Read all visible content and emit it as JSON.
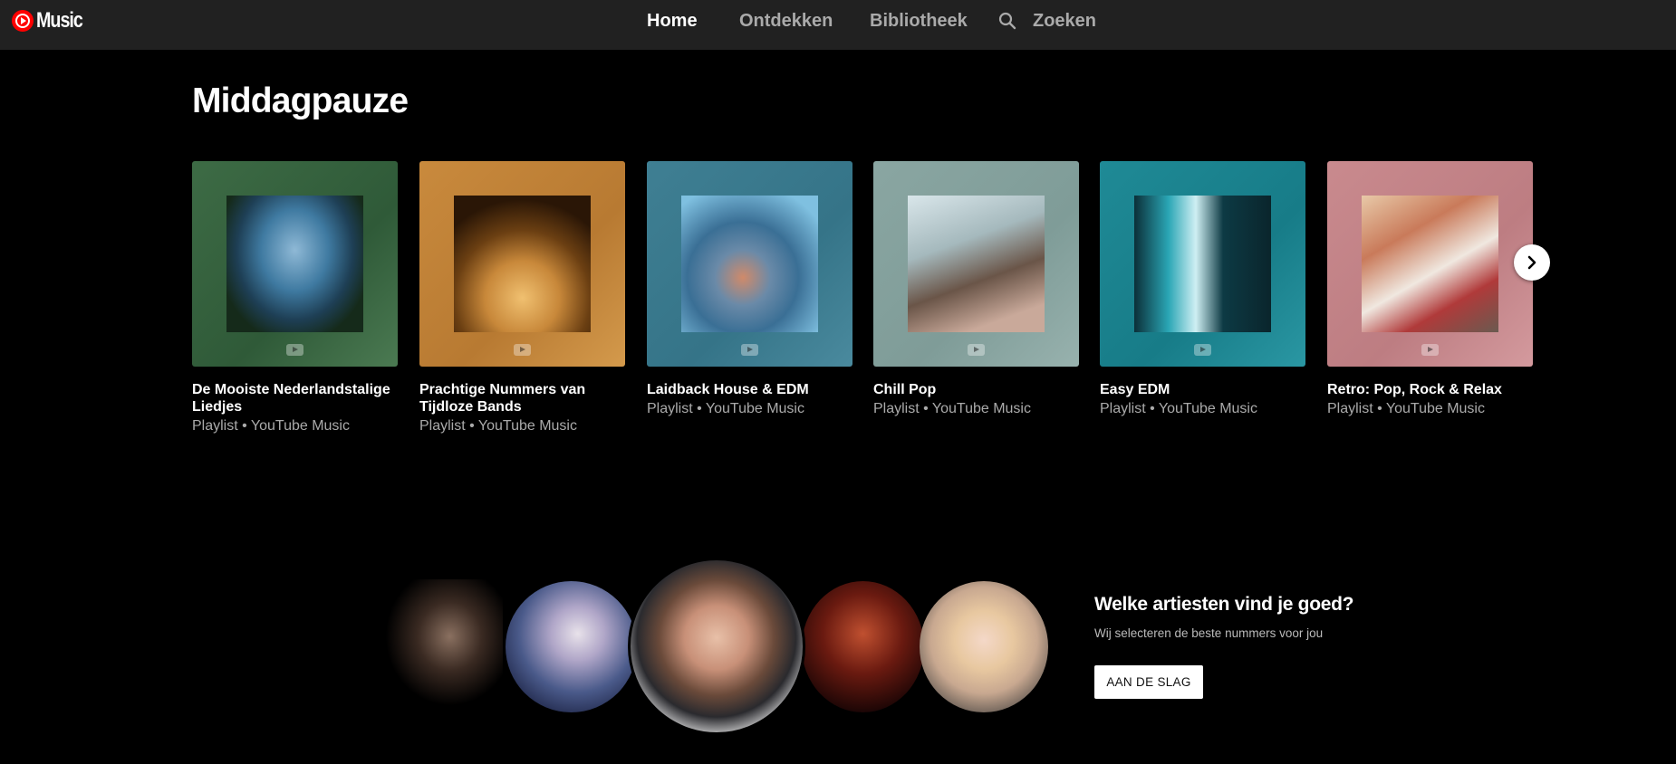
{
  "header": {
    "logo_text": "Music",
    "nav": {
      "home": "Home",
      "discover": "Ontdekken",
      "library": "Bibliotheek",
      "search": "Zoeken"
    }
  },
  "section": {
    "title": "Middagpauze",
    "cards": [
      {
        "title": "De Mooiste Nederlandstalige Liedjes",
        "subtitle": "Playlist • YouTube Music"
      },
      {
        "title": "Prachtige Nummers van Tijdloze Bands",
        "subtitle": "Playlist • YouTube Music"
      },
      {
        "title": "Laidback House & EDM",
        "subtitle": "Playlist • YouTube Music"
      },
      {
        "title": "Chill Pop",
        "subtitle": "Playlist • YouTube Music"
      },
      {
        "title": "Easy EDM",
        "subtitle": "Playlist • YouTube Music"
      },
      {
        "title": "Retro: Pop, Rock & Relax",
        "subtitle": "Playlist • YouTube Music"
      }
    ]
  },
  "promo": {
    "title": "Welke artiesten vind je goed?",
    "subtitle": "Wij selecteren de beste nummers voor jou",
    "button": "AAN DE SLAG"
  },
  "colors": {
    "background": "#000000",
    "topbar": "#212121",
    "brand_red": "#ff0000",
    "muted_text": "#aaaaaa"
  }
}
